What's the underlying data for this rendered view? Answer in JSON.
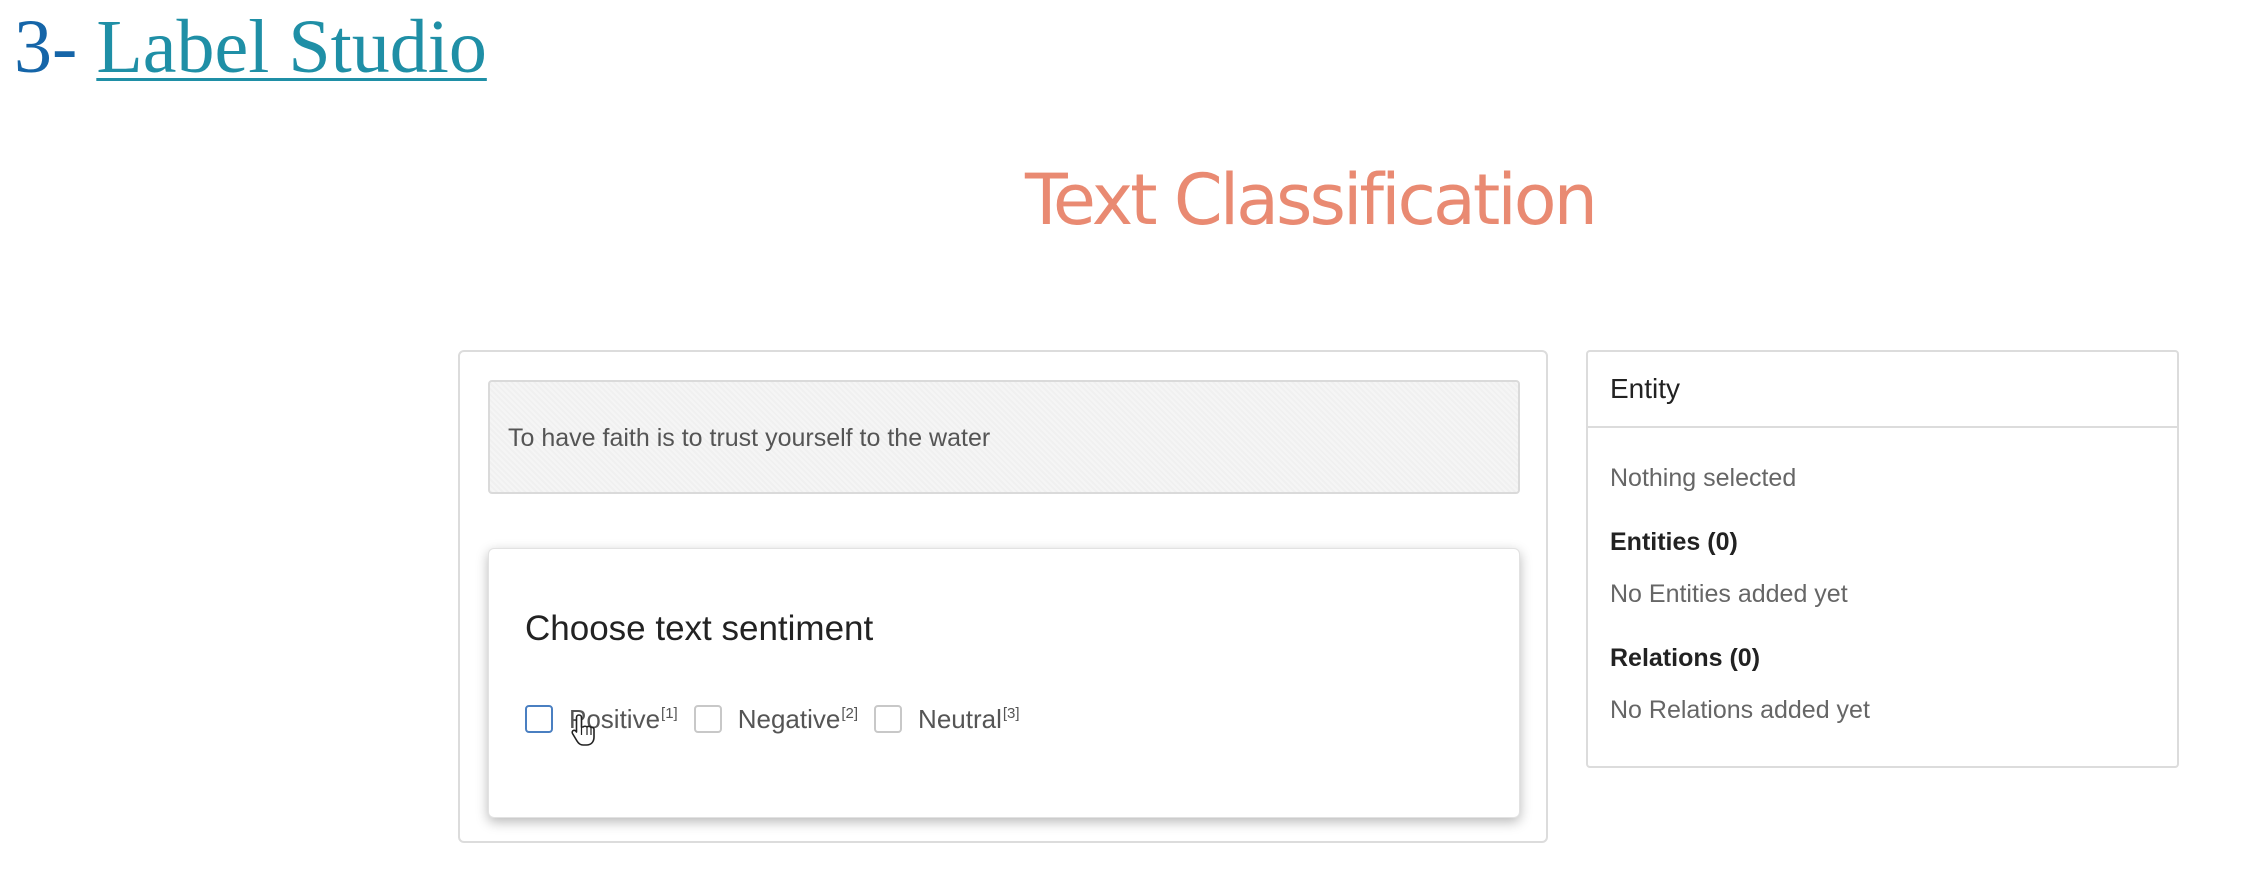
{
  "heading": {
    "number": "3- ",
    "link_text": "Label Studio"
  },
  "page_title": "Text Classification",
  "task": {
    "text": "To have faith is to trust yourself to the water",
    "question": "Choose text sentiment",
    "choices": [
      {
        "label": "Positive",
        "hotkey": "[1]"
      },
      {
        "label": "Negative",
        "hotkey": "[2]"
      },
      {
        "label": "Neutral",
        "hotkey": "[3]"
      }
    ]
  },
  "side_panel": {
    "header": "Entity",
    "nothing_selected": "Nothing selected",
    "entities_title": "Entities (0)",
    "entities_empty": "No Entities added yet",
    "relations_title": "Relations (0)",
    "relations_empty": "No Relations added yet"
  },
  "icons": {
    "cursor": "hand-pointer-icon"
  },
  "colors": {
    "heading": "#1565a8",
    "link": "#1f8fa6",
    "title": "#e98a72",
    "checkbox_hover": "#4a7fc1"
  }
}
